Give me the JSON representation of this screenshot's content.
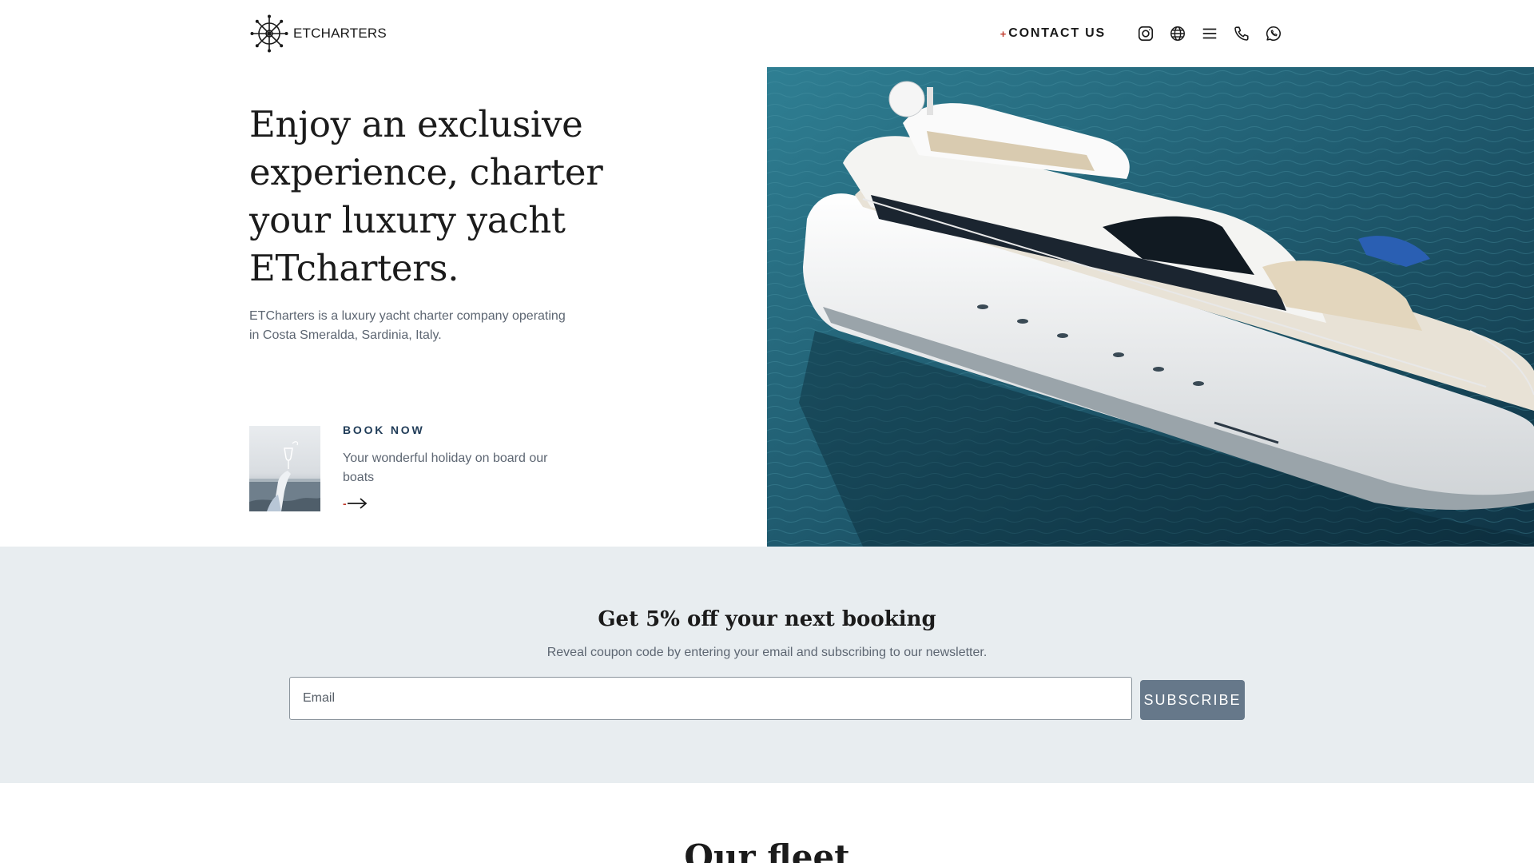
{
  "header": {
    "logo_text": "ETCHARTERS",
    "contact_plus": "+",
    "contact_label": "CONTACT US",
    "icons": [
      "instagram-icon",
      "globe-icon",
      "menu-icon",
      "phone-icon",
      "whatsapp-icon"
    ]
  },
  "hero": {
    "title": "Enjoy an exclusive experience, charter your luxury yacht ETcharters.",
    "description": "ETCharters is a luxury yacht charter company operating in Costa Smeralda, Sardinia, Italy.",
    "book": {
      "label": "BOOK NOW",
      "text": "Your wonderful holiday on board our boats",
      "arrow_dash": "-"
    }
  },
  "newsletter": {
    "title": "Get 5% off your next booking",
    "subtitle": "Reveal coupon code by entering your email and subscribing to our newsletter.",
    "email_placeholder": "Email",
    "email_value": "",
    "button_label": "SUBSCRIBE"
  },
  "fleet": {
    "title": "Our fleet"
  },
  "colors": {
    "accent_red": "#c0392b",
    "navy": "#1f3b57",
    "newsletter_bg": "#e8edf0",
    "button_bg": "#66788a",
    "sea": "#1f5a6e"
  }
}
